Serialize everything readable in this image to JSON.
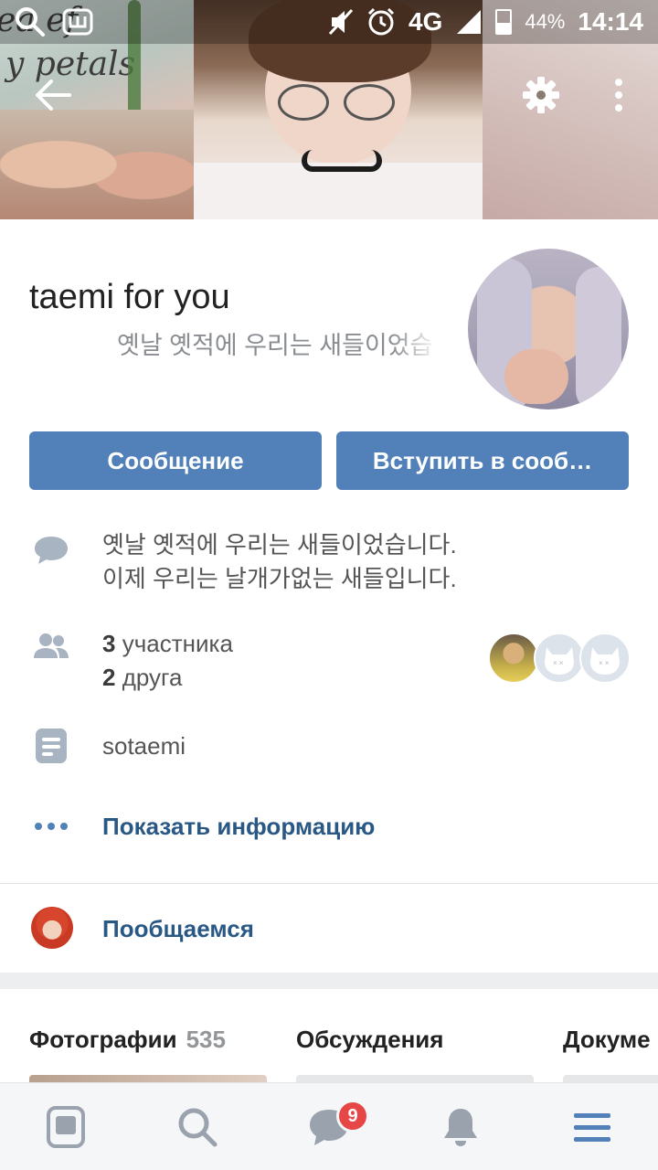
{
  "status_bar": {
    "network": "4G",
    "battery_percent": "44%",
    "time": "14:14",
    "battery_level": 0.44,
    "icons": [
      "search-icon",
      "vk-w-icon",
      "mute-icon",
      "alarm-icon",
      "signal-icon",
      "battery-icon"
    ]
  },
  "cover": {
    "text_line1": "ea ef",
    "text_line2": "y petals"
  },
  "header": {
    "group_name": "taemi for you",
    "status": "옛날 옛적에 우리는 새들이었습"
  },
  "buttons": {
    "message": "Сообщение",
    "join": "Вступить в сооб…"
  },
  "info": {
    "description_line1": "옛날 옛적에 우리는 새들이었습니다.",
    "description_line2": "이제 우리는 날개가없는 새들입니다.",
    "members_count": "3",
    "members_label": "участника",
    "friends_count": "2",
    "friends_label": "друга",
    "screen_name": "sotaemi",
    "show_info": "Показать информацию"
  },
  "chat": {
    "label": "Пообщаемся"
  },
  "sections": {
    "photos": "Фотографии",
    "photos_count": "535",
    "discussions": "Обсуждения",
    "documents": "Докуме"
  },
  "bottom_nav": {
    "messages_badge": "9",
    "items": [
      "news-icon",
      "search-icon",
      "messages-icon",
      "notifications-icon",
      "menu-icon"
    ]
  },
  "colors": {
    "accent": "#5181b8",
    "link": "#2a5885",
    "badge": "#e64646",
    "secondary_text": "#939699"
  }
}
